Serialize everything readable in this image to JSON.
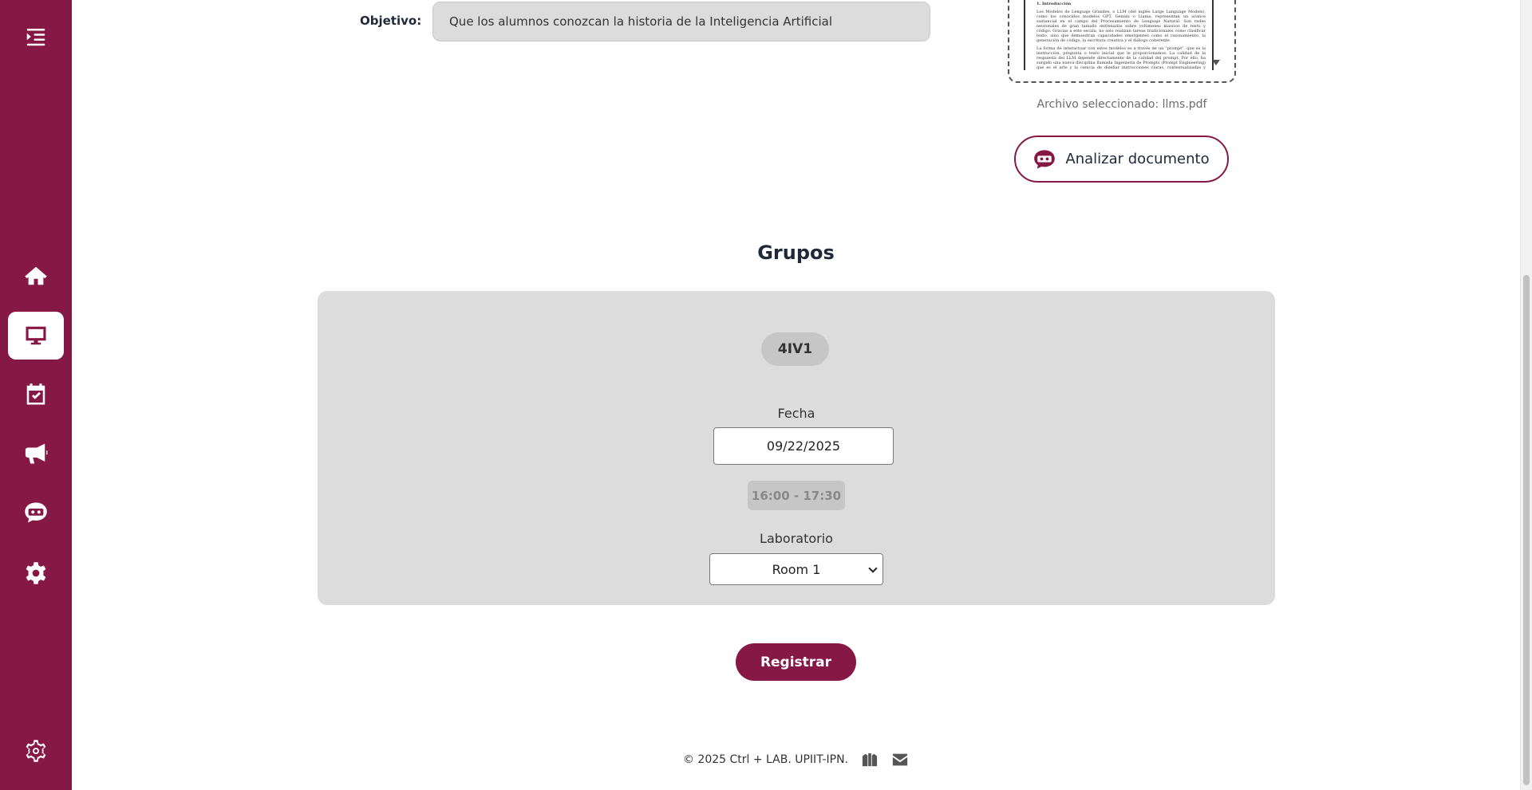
{
  "objective": {
    "label": "Objetivo:",
    "value": "Que los alumnos conozcan la historia de la Inteligencia Artificial"
  },
  "document": {
    "preview_heading": "1. Introducción",
    "preview_paragraphs": [
      "Los Modelos de Lenguaje Grandes, o LLM (del inglés Large Language Models), como los conocidos modelos GPT, Gemini o Llama, representan un avance sustancial en el campo del Procesamiento de Lenguaje Natural. Son redes neuronales de gran tamaño entrenadas sobre volúmenes masivos de texto y código. Gracias a este escala, no solo realizan tareas tradicionales como clasificar texto, sino que demuestran capacidades emergentes como el razonamiento, la generación de código, la escritura creativa y el diálogo coherente.",
      "La forma de interactuar con estos modelos es a través de un \"prompt\", que es la instrucción, pregunta o texto inicial que le proporcionamos. La calidad de la respuesta del LLM depende directamente de la calidad del prompt. Por ello, ha surgido una nueva disciplina llamada Ingeniería de Prompts (Prompt Engineering) que es el arte y la ciencia de diseñar instrucciones claras, contextualizadas y específicas para guiar al modelo a obtener los resultados más precisos y deseados."
    ],
    "selected_file": "Archivo seleccionado: llms.pdf",
    "analyze_label": "Analizar documento"
  },
  "groups": {
    "title": "Grupos",
    "items": [
      {
        "name": "4IV1",
        "date_label": "Fecha",
        "date_value": "09/22/2025",
        "time": "16:00 - 17:30",
        "lab_label": "Laboratorio",
        "lab_value": "Room 1"
      }
    ]
  },
  "actions": {
    "register_label": "Registrar"
  },
  "footer": {
    "text": "© 2025 Ctrl + LAB. UPIIT-IPN."
  },
  "sidebar": {
    "items": [
      {
        "icon": "menu-toggle-icon"
      },
      {
        "icon": "home-icon"
      },
      {
        "icon": "monitor-icon",
        "active": true
      },
      {
        "icon": "calendar-check-icon"
      },
      {
        "icon": "megaphone-icon"
      },
      {
        "icon": "chatbot-icon"
      },
      {
        "icon": "settings-icon"
      },
      {
        "icon": "gear-outline-icon"
      }
    ]
  },
  "colors": {
    "brand": "#861846",
    "panel": "#dcdcdc",
    "pill": "#c6c6c6"
  }
}
